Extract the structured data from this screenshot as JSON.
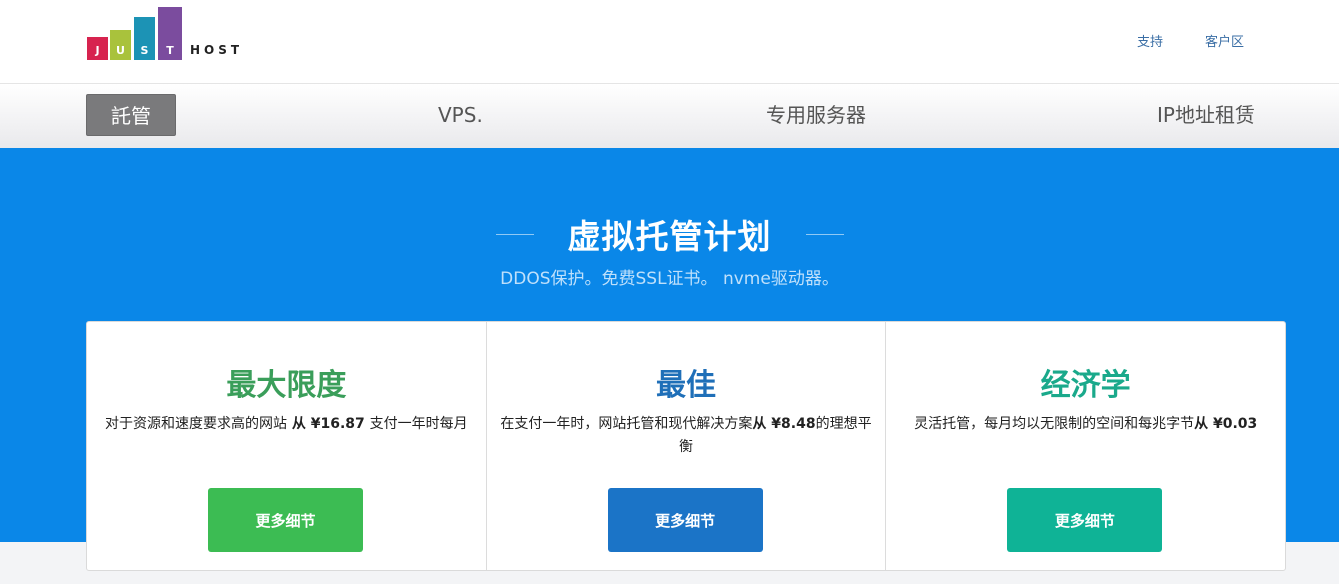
{
  "logo": {
    "letters": [
      "J",
      "U",
      "S",
      "T"
    ],
    "host": "HOST",
    "colors": [
      "#d7234f",
      "#a9c23c",
      "#1c93b5",
      "#7b4c9e"
    ]
  },
  "top_links": [
    "支持",
    "客户区"
  ],
  "nav": {
    "items": [
      {
        "label": "託管",
        "active": true
      },
      {
        "label": "VPS.",
        "active": false
      },
      {
        "label": "专用服务器",
        "active": false
      },
      {
        "label": "IP地址租赁",
        "active": false
      }
    ]
  },
  "hero": {
    "title": "虚拟托管计划",
    "subtitle": "DDOS保护。免费SSL证书。 nvme驱动器。"
  },
  "plans": [
    {
      "title": "最大限度",
      "title_color": "#3a9e5a",
      "desc_text": "对于资源和速度要求高的网站",
      "desc_price": " 从 ¥16.87 ",
      "desc_tail": "支付一年时每月",
      "button": "更多细节",
      "button_color": "#3cbc53"
    },
    {
      "title": "最佳",
      "title_color": "#1f6fb8",
      "desc_text": "在支付一年时，网站托管和现代解决方案",
      "desc_price": "从 ¥8.48",
      "desc_tail": "的理想平衡",
      "button": "更多细节",
      "button_color": "#1b74c7"
    },
    {
      "title": "经济学",
      "title_color": "#1aa98b",
      "desc_text": "灵活托管，每月均以无限制的空间和每兆字节",
      "desc_price": "从 ¥0.03",
      "desc_tail": "",
      "button": "更多细节",
      "button_color": "#0fb396"
    }
  ]
}
